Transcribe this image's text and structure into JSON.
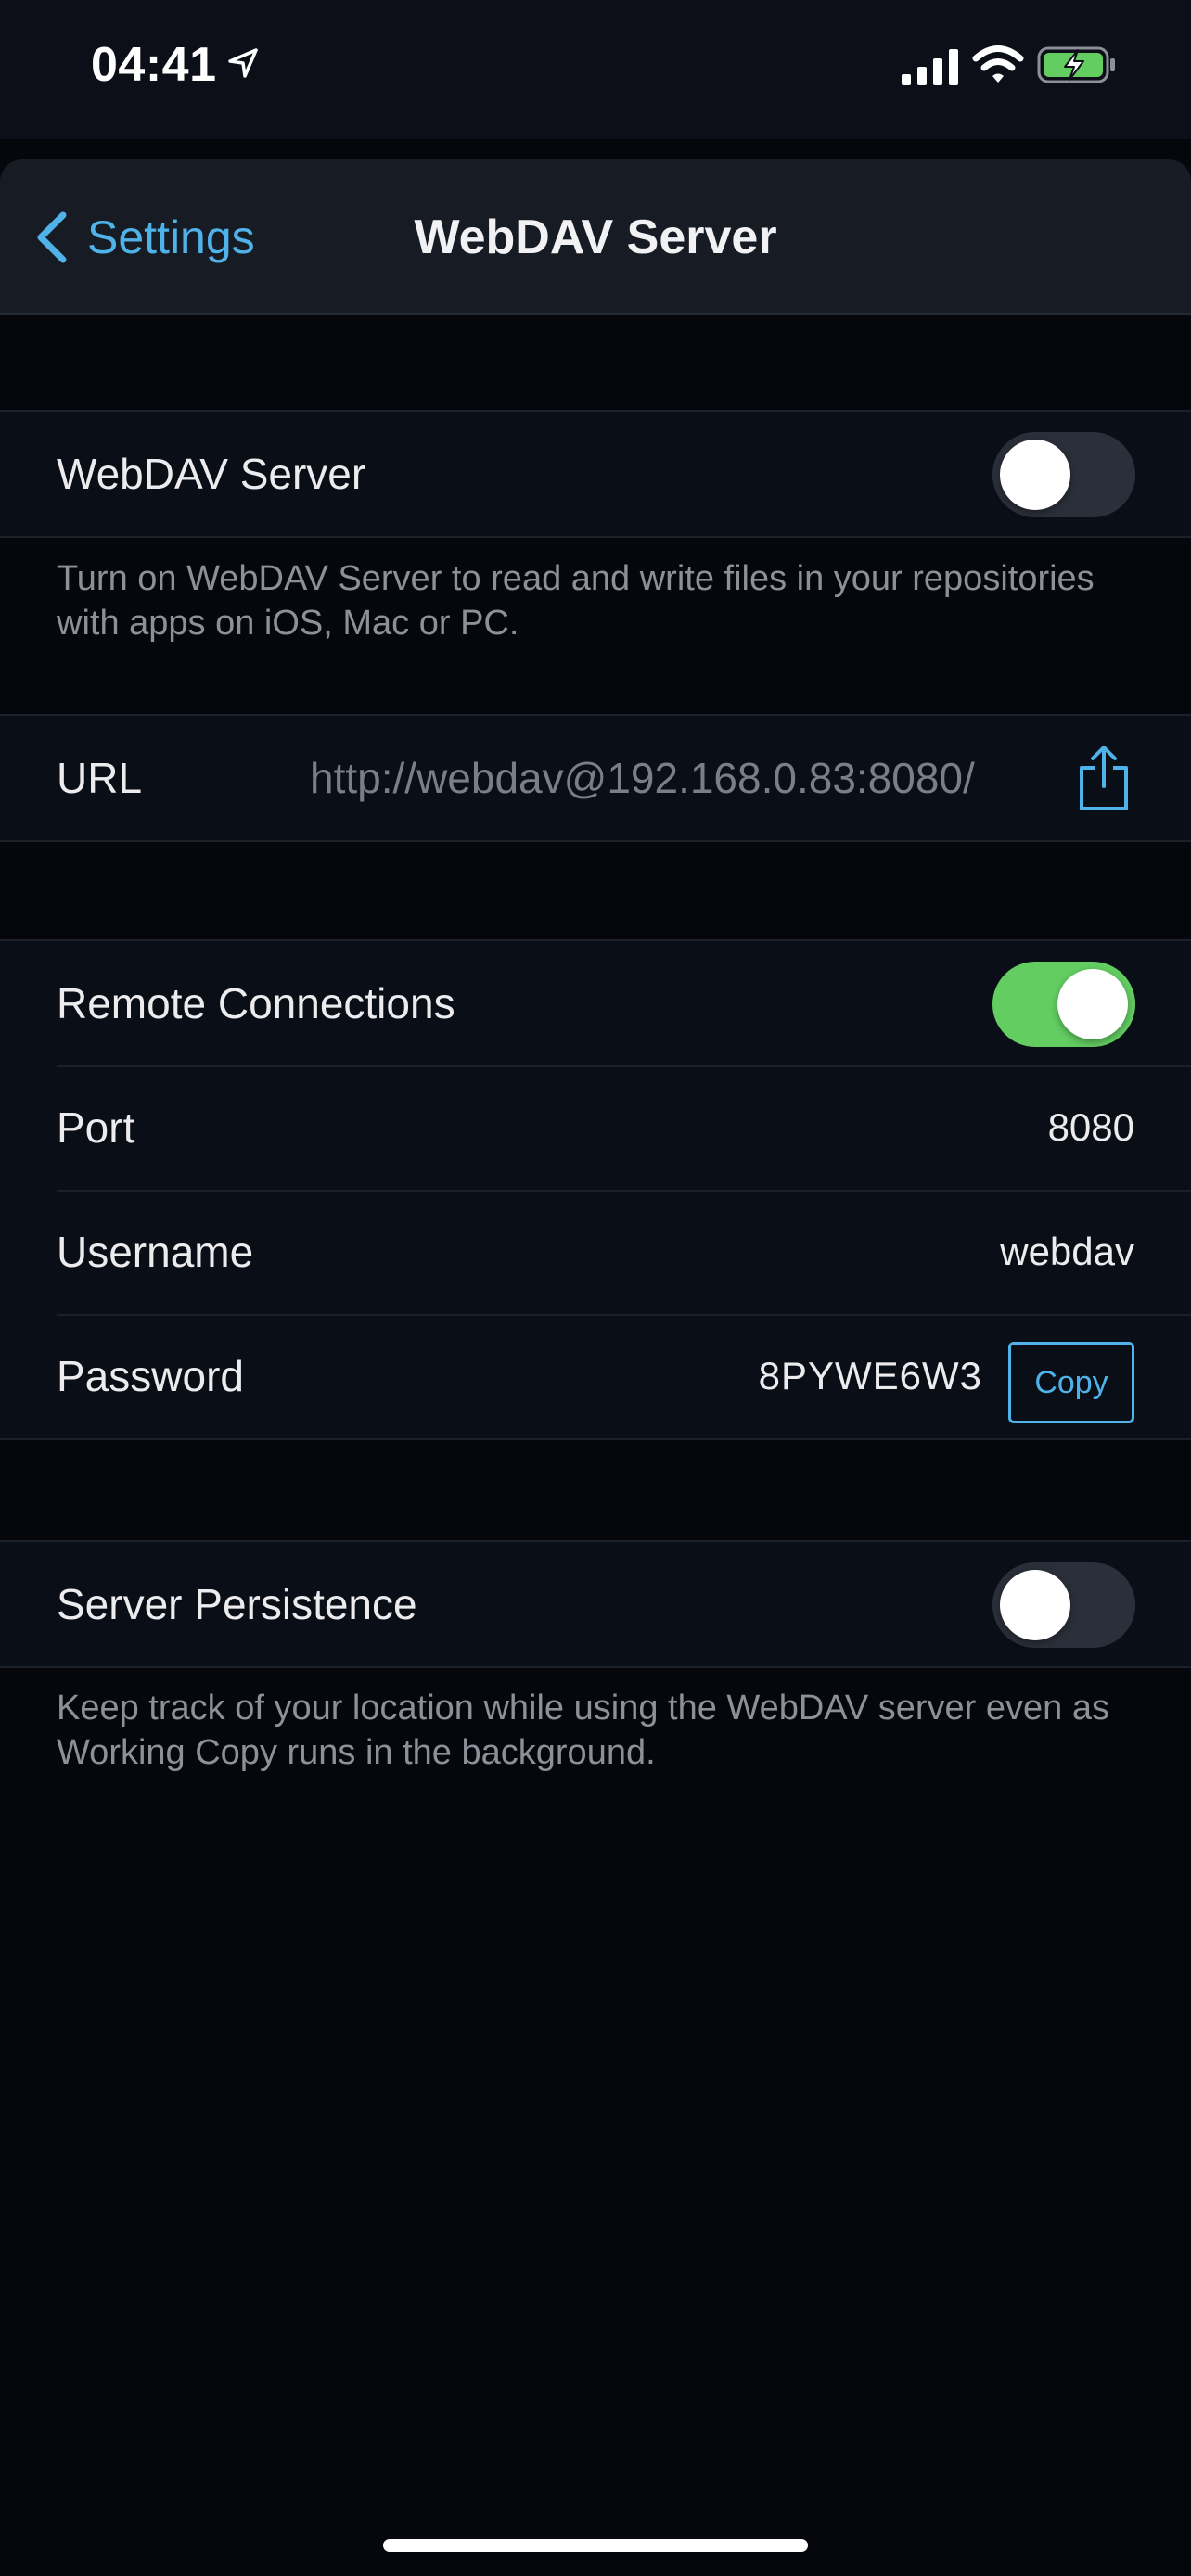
{
  "status_bar": {
    "time": "04:41"
  },
  "nav": {
    "back_label": "Settings",
    "title": "WebDAV Server"
  },
  "webdav_section": {
    "label": "WebDAV Server",
    "toggle_on": false,
    "footer": "Turn on WebDAV Server to read and write files in your repositories with apps on iOS, Mac or PC."
  },
  "url_section": {
    "label": "URL",
    "value": "http://webdav@192.168.0.83:8080/"
  },
  "remote_section": {
    "remote_label": "Remote Connections",
    "remote_toggle_on": true,
    "port_label": "Port",
    "port_value": "8080",
    "username_label": "Username",
    "username_value": "webdav",
    "password_label": "Password",
    "password_value": "8PYWE6W3",
    "copy_label": "Copy"
  },
  "persistence_section": {
    "label": "Server Persistence",
    "toggle_on": false,
    "footer": "Keep track of your location while using the WebDAV server even as Working Copy runs in the background."
  },
  "colors": {
    "accent": "#4fb2e8",
    "toggle_on": "#63cd62",
    "battery": "#63cd62"
  }
}
